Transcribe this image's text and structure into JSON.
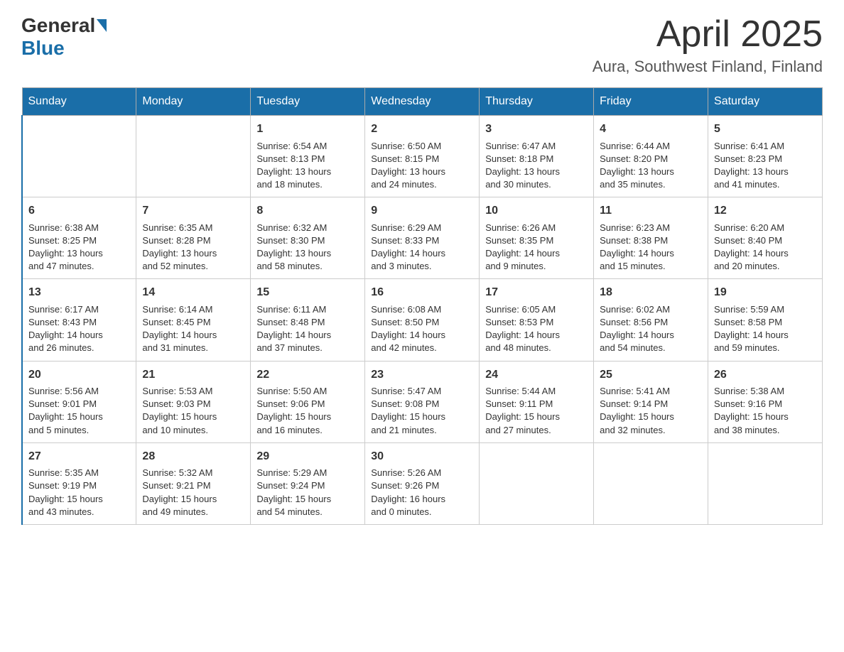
{
  "header": {
    "logo_general": "General",
    "logo_blue": "Blue",
    "month": "April 2025",
    "location": "Aura, Southwest Finland, Finland"
  },
  "days_of_week": [
    "Sunday",
    "Monday",
    "Tuesday",
    "Wednesday",
    "Thursday",
    "Friday",
    "Saturday"
  ],
  "weeks": [
    [
      {
        "day": "",
        "info": ""
      },
      {
        "day": "",
        "info": ""
      },
      {
        "day": "1",
        "info": "Sunrise: 6:54 AM\nSunset: 8:13 PM\nDaylight: 13 hours\nand 18 minutes."
      },
      {
        "day": "2",
        "info": "Sunrise: 6:50 AM\nSunset: 8:15 PM\nDaylight: 13 hours\nand 24 minutes."
      },
      {
        "day": "3",
        "info": "Sunrise: 6:47 AM\nSunset: 8:18 PM\nDaylight: 13 hours\nand 30 minutes."
      },
      {
        "day": "4",
        "info": "Sunrise: 6:44 AM\nSunset: 8:20 PM\nDaylight: 13 hours\nand 35 minutes."
      },
      {
        "day": "5",
        "info": "Sunrise: 6:41 AM\nSunset: 8:23 PM\nDaylight: 13 hours\nand 41 minutes."
      }
    ],
    [
      {
        "day": "6",
        "info": "Sunrise: 6:38 AM\nSunset: 8:25 PM\nDaylight: 13 hours\nand 47 minutes."
      },
      {
        "day": "7",
        "info": "Sunrise: 6:35 AM\nSunset: 8:28 PM\nDaylight: 13 hours\nand 52 minutes."
      },
      {
        "day": "8",
        "info": "Sunrise: 6:32 AM\nSunset: 8:30 PM\nDaylight: 13 hours\nand 58 minutes."
      },
      {
        "day": "9",
        "info": "Sunrise: 6:29 AM\nSunset: 8:33 PM\nDaylight: 14 hours\nand 3 minutes."
      },
      {
        "day": "10",
        "info": "Sunrise: 6:26 AM\nSunset: 8:35 PM\nDaylight: 14 hours\nand 9 minutes."
      },
      {
        "day": "11",
        "info": "Sunrise: 6:23 AM\nSunset: 8:38 PM\nDaylight: 14 hours\nand 15 minutes."
      },
      {
        "day": "12",
        "info": "Sunrise: 6:20 AM\nSunset: 8:40 PM\nDaylight: 14 hours\nand 20 minutes."
      }
    ],
    [
      {
        "day": "13",
        "info": "Sunrise: 6:17 AM\nSunset: 8:43 PM\nDaylight: 14 hours\nand 26 minutes."
      },
      {
        "day": "14",
        "info": "Sunrise: 6:14 AM\nSunset: 8:45 PM\nDaylight: 14 hours\nand 31 minutes."
      },
      {
        "day": "15",
        "info": "Sunrise: 6:11 AM\nSunset: 8:48 PM\nDaylight: 14 hours\nand 37 minutes."
      },
      {
        "day": "16",
        "info": "Sunrise: 6:08 AM\nSunset: 8:50 PM\nDaylight: 14 hours\nand 42 minutes."
      },
      {
        "day": "17",
        "info": "Sunrise: 6:05 AM\nSunset: 8:53 PM\nDaylight: 14 hours\nand 48 minutes."
      },
      {
        "day": "18",
        "info": "Sunrise: 6:02 AM\nSunset: 8:56 PM\nDaylight: 14 hours\nand 54 minutes."
      },
      {
        "day": "19",
        "info": "Sunrise: 5:59 AM\nSunset: 8:58 PM\nDaylight: 14 hours\nand 59 minutes."
      }
    ],
    [
      {
        "day": "20",
        "info": "Sunrise: 5:56 AM\nSunset: 9:01 PM\nDaylight: 15 hours\nand 5 minutes."
      },
      {
        "day": "21",
        "info": "Sunrise: 5:53 AM\nSunset: 9:03 PM\nDaylight: 15 hours\nand 10 minutes."
      },
      {
        "day": "22",
        "info": "Sunrise: 5:50 AM\nSunset: 9:06 PM\nDaylight: 15 hours\nand 16 minutes."
      },
      {
        "day": "23",
        "info": "Sunrise: 5:47 AM\nSunset: 9:08 PM\nDaylight: 15 hours\nand 21 minutes."
      },
      {
        "day": "24",
        "info": "Sunrise: 5:44 AM\nSunset: 9:11 PM\nDaylight: 15 hours\nand 27 minutes."
      },
      {
        "day": "25",
        "info": "Sunrise: 5:41 AM\nSunset: 9:14 PM\nDaylight: 15 hours\nand 32 minutes."
      },
      {
        "day": "26",
        "info": "Sunrise: 5:38 AM\nSunset: 9:16 PM\nDaylight: 15 hours\nand 38 minutes."
      }
    ],
    [
      {
        "day": "27",
        "info": "Sunrise: 5:35 AM\nSunset: 9:19 PM\nDaylight: 15 hours\nand 43 minutes."
      },
      {
        "day": "28",
        "info": "Sunrise: 5:32 AM\nSunset: 9:21 PM\nDaylight: 15 hours\nand 49 minutes."
      },
      {
        "day": "29",
        "info": "Sunrise: 5:29 AM\nSunset: 9:24 PM\nDaylight: 15 hours\nand 54 minutes."
      },
      {
        "day": "30",
        "info": "Sunrise: 5:26 AM\nSunset: 9:26 PM\nDaylight: 16 hours\nand 0 minutes."
      },
      {
        "day": "",
        "info": ""
      },
      {
        "day": "",
        "info": ""
      },
      {
        "day": "",
        "info": ""
      }
    ]
  ]
}
